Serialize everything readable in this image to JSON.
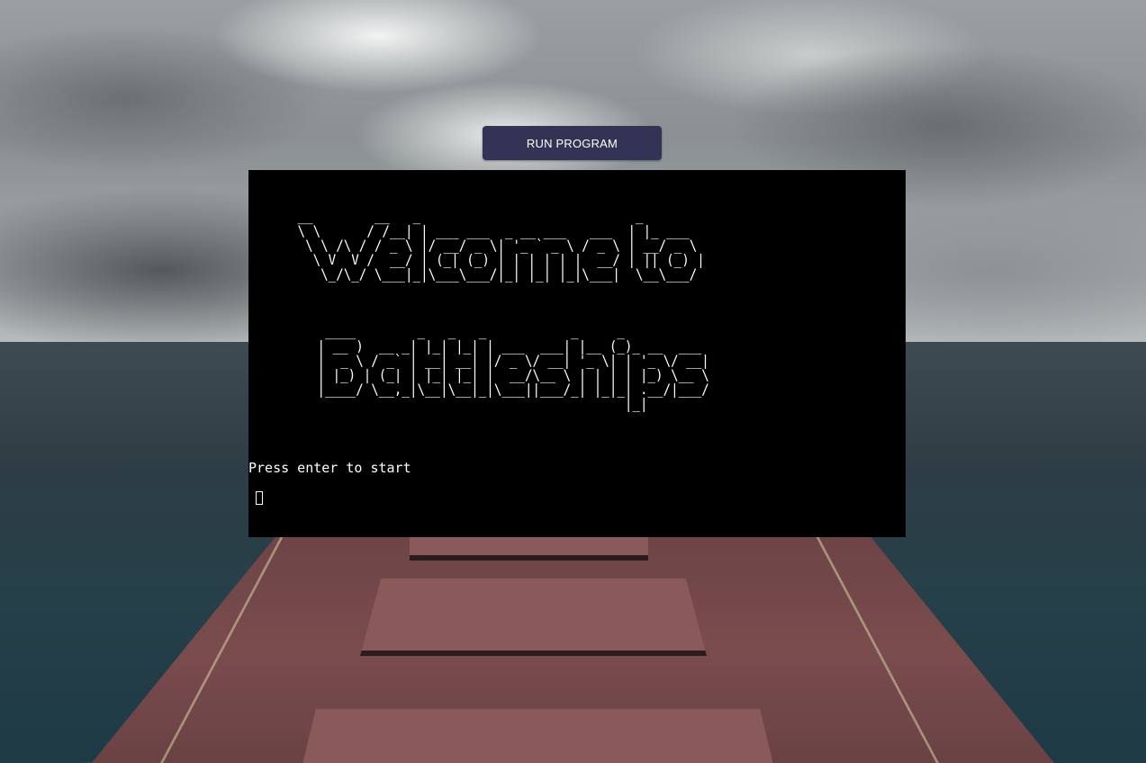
{
  "app": {
    "run_button_label": "RUN PROGRAM"
  },
  "terminal": {
    "ascii_welcome": " __        __   _                            _        \n \\ \\      / /__| | ___ ___  _ __ ___   ___  | |_ ___  \n  \\ \\ /\\ / / _ \\ |/ __/ _ \\| '_ ` _ \\ / _ \\ | __/ _ \\ \n   \\ V  V /  __/ | (_| (_) | | | | | |  __/ | || (_) |\n    \\_/\\_/ \\___|_|\\___\\___/|_| |_| |_|\\___|  \\__\\___/ ",
    "ascii_battleships": "  ____        _   _   _           _     _           \n | __ )  __ _| |_| |_| | ___  ___| |__ (_)_ __  ___ \n |  _ \\ / _` | __| __| |/ _ \\/ __| '_ \\| | '_ \\/ __|\n | |_) | (_| | |_| |_| |  __/\\__ \\ | | | | |_) \\__ \\\n |____/ \\__,_|\\__|\\__|_|\\___||___/_| |_|_| .__/|___/\n                                         |_|        ",
    "prompt_text": "Press enter to start"
  },
  "colors": {
    "button_bg": "#333455",
    "terminal_bg": "#000000",
    "terminal_fg": "#ffffff"
  }
}
